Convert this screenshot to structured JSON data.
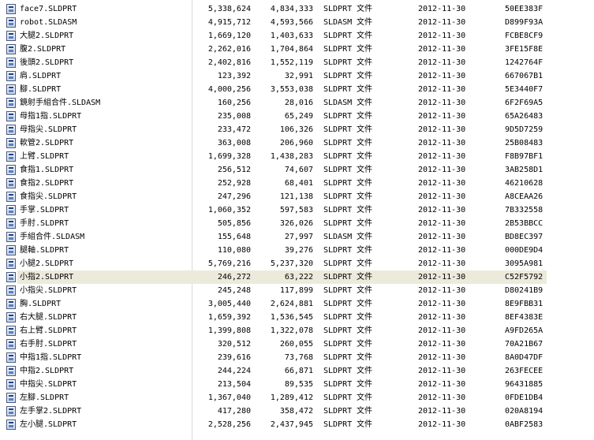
{
  "file_type_label": "文件",
  "files": [
    {
      "name": "face7.SLDPRT",
      "size": "5,338,624",
      "packed": "4,834,333",
      "type": "SLDPRT",
      "date": "2012-11-30",
      "crc": "50EE383F",
      "icon": "sldprt-file-icon"
    },
    {
      "name": "robot.SLDASM",
      "size": "4,915,712",
      "packed": "4,593,566",
      "type": "SLDASM",
      "date": "2012-11-30",
      "crc": "D899F93A",
      "icon": "sldasm-file-icon"
    },
    {
      "name": "大腿2.SLDPRT",
      "size": "1,669,120",
      "packed": "1,403,633",
      "type": "SLDPRT",
      "date": "2012-11-30",
      "crc": "FCBE8CF9",
      "icon": "sldprt-file-icon"
    },
    {
      "name": "腹2.SLDPRT",
      "size": "2,262,016",
      "packed": "1,704,864",
      "type": "SLDPRT",
      "date": "2012-11-30",
      "crc": "3FE15F8E",
      "icon": "sldprt-file-icon"
    },
    {
      "name": "後頭2.SLDPRT",
      "size": "2,402,816",
      "packed": "1,552,119",
      "type": "SLDPRT",
      "date": "2012-11-30",
      "crc": "1242764F",
      "icon": "sldprt-file-icon"
    },
    {
      "name": "肩.SLDPRT",
      "size": "123,392",
      "packed": "32,991",
      "type": "SLDPRT",
      "date": "2012-11-30",
      "crc": "667067B1",
      "icon": "sldprt-file-icon"
    },
    {
      "name": "腳.SLDPRT",
      "size": "4,000,256",
      "packed": "3,553,038",
      "type": "SLDPRT",
      "date": "2012-11-30",
      "crc": "5E3440F7",
      "icon": "sldprt-file-icon"
    },
    {
      "name": "鏡射手組合件.SLDASM",
      "size": "160,256",
      "packed": "28,016",
      "type": "SLDASM",
      "date": "2012-11-30",
      "crc": "6F2F69A5",
      "icon": "sldasm-file-icon"
    },
    {
      "name": "母指1指.SLDPRT",
      "size": "235,008",
      "packed": "65,249",
      "type": "SLDPRT",
      "date": "2012-11-30",
      "crc": "65A26483",
      "icon": "sldprt-file-icon"
    },
    {
      "name": "母指尖.SLDPRT",
      "size": "233,472",
      "packed": "106,326",
      "type": "SLDPRT",
      "date": "2012-11-30",
      "crc": "9D5D7259",
      "icon": "sldprt-file-icon"
    },
    {
      "name": "軟管2.SLDPRT",
      "size": "363,008",
      "packed": "206,960",
      "type": "SLDPRT",
      "date": "2012-11-30",
      "crc": "25B08483",
      "icon": "sldprt-file-icon"
    },
    {
      "name": "上臂.SLDPRT",
      "size": "1,699,328",
      "packed": "1,438,283",
      "type": "SLDPRT",
      "date": "2012-11-30",
      "crc": "F8B97BF1",
      "icon": "sldprt-file-icon"
    },
    {
      "name": "食指1.SLDPRT",
      "size": "256,512",
      "packed": "74,607",
      "type": "SLDPRT",
      "date": "2012-11-30",
      "crc": "3AB258D1",
      "icon": "sldprt-file-icon"
    },
    {
      "name": "食指2.SLDPRT",
      "size": "252,928",
      "packed": "68,401",
      "type": "SLDPRT",
      "date": "2012-11-30",
      "crc": "46210628",
      "icon": "sldprt-file-icon"
    },
    {
      "name": "食指尖.SLDPRT",
      "size": "247,296",
      "packed": "121,138",
      "type": "SLDPRT",
      "date": "2012-11-30",
      "crc": "A8CEAA26",
      "icon": "sldprt-file-icon"
    },
    {
      "name": "手掌.SLDPRT",
      "size": "1,060,352",
      "packed": "597,583",
      "type": "SLDPRT",
      "date": "2012-11-30",
      "crc": "7B332558",
      "icon": "sldprt-file-icon"
    },
    {
      "name": "手肘.SLDPRT",
      "size": "505,856",
      "packed": "326,026",
      "type": "SLDPRT",
      "date": "2012-11-30",
      "crc": "2B53BBCC",
      "icon": "sldprt-file-icon"
    },
    {
      "name": "手組合件.SLDASM",
      "size": "155,648",
      "packed": "27,997",
      "type": "SLDASM",
      "date": "2012-11-30",
      "crc": "BD8EC397",
      "icon": "sldasm-file-icon"
    },
    {
      "name": "腿軸.SLDPRT",
      "size": "110,080",
      "packed": "39,276",
      "type": "SLDPRT",
      "date": "2012-11-30",
      "crc": "000DE9D4",
      "icon": "sldprt-file-icon"
    },
    {
      "name": "小腿2.SLDPRT",
      "size": "5,769,216",
      "packed": "5,237,320",
      "type": "SLDPRT",
      "date": "2012-11-30",
      "crc": "3095A981",
      "icon": "sldprt-file-icon"
    },
    {
      "name": "小指2.SLDPRT",
      "size": "246,272",
      "packed": "63,222",
      "type": "SLDPRT",
      "date": "2012-11-30",
      "crc": "C52F5792",
      "icon": "sldprt-file-icon",
      "selected": true
    },
    {
      "name": "小指尖.SLDPRT",
      "size": "245,248",
      "packed": "117,899",
      "type": "SLDPRT",
      "date": "2012-11-30",
      "crc": "D80241B9",
      "icon": "sldprt-file-icon"
    },
    {
      "name": "胸.SLDPRT",
      "size": "3,005,440",
      "packed": "2,624,881",
      "type": "SLDPRT",
      "date": "2012-11-30",
      "crc": "8E9FBB31",
      "icon": "sldprt-file-icon"
    },
    {
      "name": "右大腿.SLDPRT",
      "size": "1,659,392",
      "packed": "1,536,545",
      "type": "SLDPRT",
      "date": "2012-11-30",
      "crc": "8EF4383E",
      "icon": "sldprt-file-icon"
    },
    {
      "name": "右上臂.SLDPRT",
      "size": "1,399,808",
      "packed": "1,322,078",
      "type": "SLDPRT",
      "date": "2012-11-30",
      "crc": "A9FD265A",
      "icon": "sldprt-file-icon"
    },
    {
      "name": "右手肘.SLDPRT",
      "size": "320,512",
      "packed": "260,055",
      "type": "SLDPRT",
      "date": "2012-11-30",
      "crc": "70A21B67",
      "icon": "sldprt-file-icon"
    },
    {
      "name": "中指1指.SLDPRT",
      "size": "239,616",
      "packed": "73,768",
      "type": "SLDPRT",
      "date": "2012-11-30",
      "crc": "8A0D47DF",
      "icon": "sldprt-file-icon"
    },
    {
      "name": "中指2.SLDPRT",
      "size": "244,224",
      "packed": "66,871",
      "type": "SLDPRT",
      "date": "2012-11-30",
      "crc": "263FECEE",
      "icon": "sldprt-file-icon"
    },
    {
      "name": "中指尖.SLDPRT",
      "size": "213,504",
      "packed": "89,535",
      "type": "SLDPRT",
      "date": "2012-11-30",
      "crc": "96431885",
      "icon": "sldprt-file-icon"
    },
    {
      "name": "左腳.SLDPRT",
      "size": "1,367,040",
      "packed": "1,289,412",
      "type": "SLDPRT",
      "date": "2012-11-30",
      "crc": "0FDE1DB4",
      "icon": "sldprt-file-icon"
    },
    {
      "name": "左手掌2.SLDPRT",
      "size": "417,280",
      "packed": "358,472",
      "type": "SLDPRT",
      "date": "2012-11-30",
      "crc": "020A8194",
      "icon": "sldprt-file-icon"
    },
    {
      "name": "左小腿.SLDPRT",
      "size": "2,528,256",
      "packed": "2,437,945",
      "type": "SLDPRT",
      "date": "2012-11-30",
      "crc": "0ABF2583",
      "icon": "sldprt-file-icon"
    }
  ]
}
